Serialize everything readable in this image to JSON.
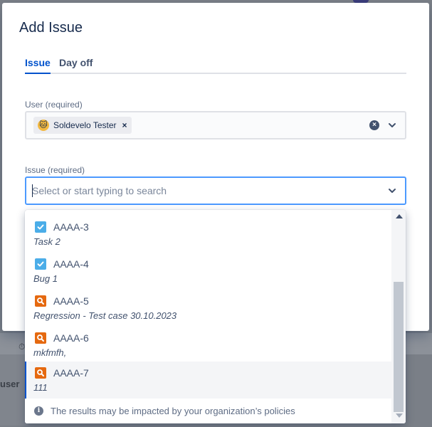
{
  "modal": {
    "title": "Add Issue",
    "tabs": [
      {
        "label": "Issue",
        "active": true
      },
      {
        "label": "Day off",
        "active": false
      }
    ]
  },
  "user_field": {
    "label": "User (required)",
    "selected_user": "Soldevelo Tester",
    "avatar_icon": "cat-avatar"
  },
  "issue_field": {
    "label": "Issue (required)",
    "value": "",
    "placeholder": "Select or start typing to search"
  },
  "dropdown": {
    "options": [
      {
        "key": "AAAA-3",
        "summary": "Task 2",
        "icon": "task-check-icon",
        "selected": false
      },
      {
        "key": "AAAA-4",
        "summary": "Bug 1",
        "icon": "task-check-icon",
        "selected": false
      },
      {
        "key": "AAAA-5",
        "summary": "Regression - Test case 30.10.2023",
        "icon": "test-magnifier-icon",
        "selected": false
      },
      {
        "key": "AAAA-6",
        "summary": "mkfmfh,",
        "icon": "test-magnifier-icon",
        "selected": false
      },
      {
        "key": "AAAA-7",
        "summary": "111",
        "icon": "test-magnifier-icon",
        "selected": true
      }
    ],
    "note": "The results may be impacted by your organization’s policies"
  },
  "background": {
    "user_column_label": "user"
  },
  "colors": {
    "accent": "#0052cc",
    "focus_border": "#4c9aff",
    "task_icon": "#4bade8",
    "test_icon": "#e56910"
  }
}
